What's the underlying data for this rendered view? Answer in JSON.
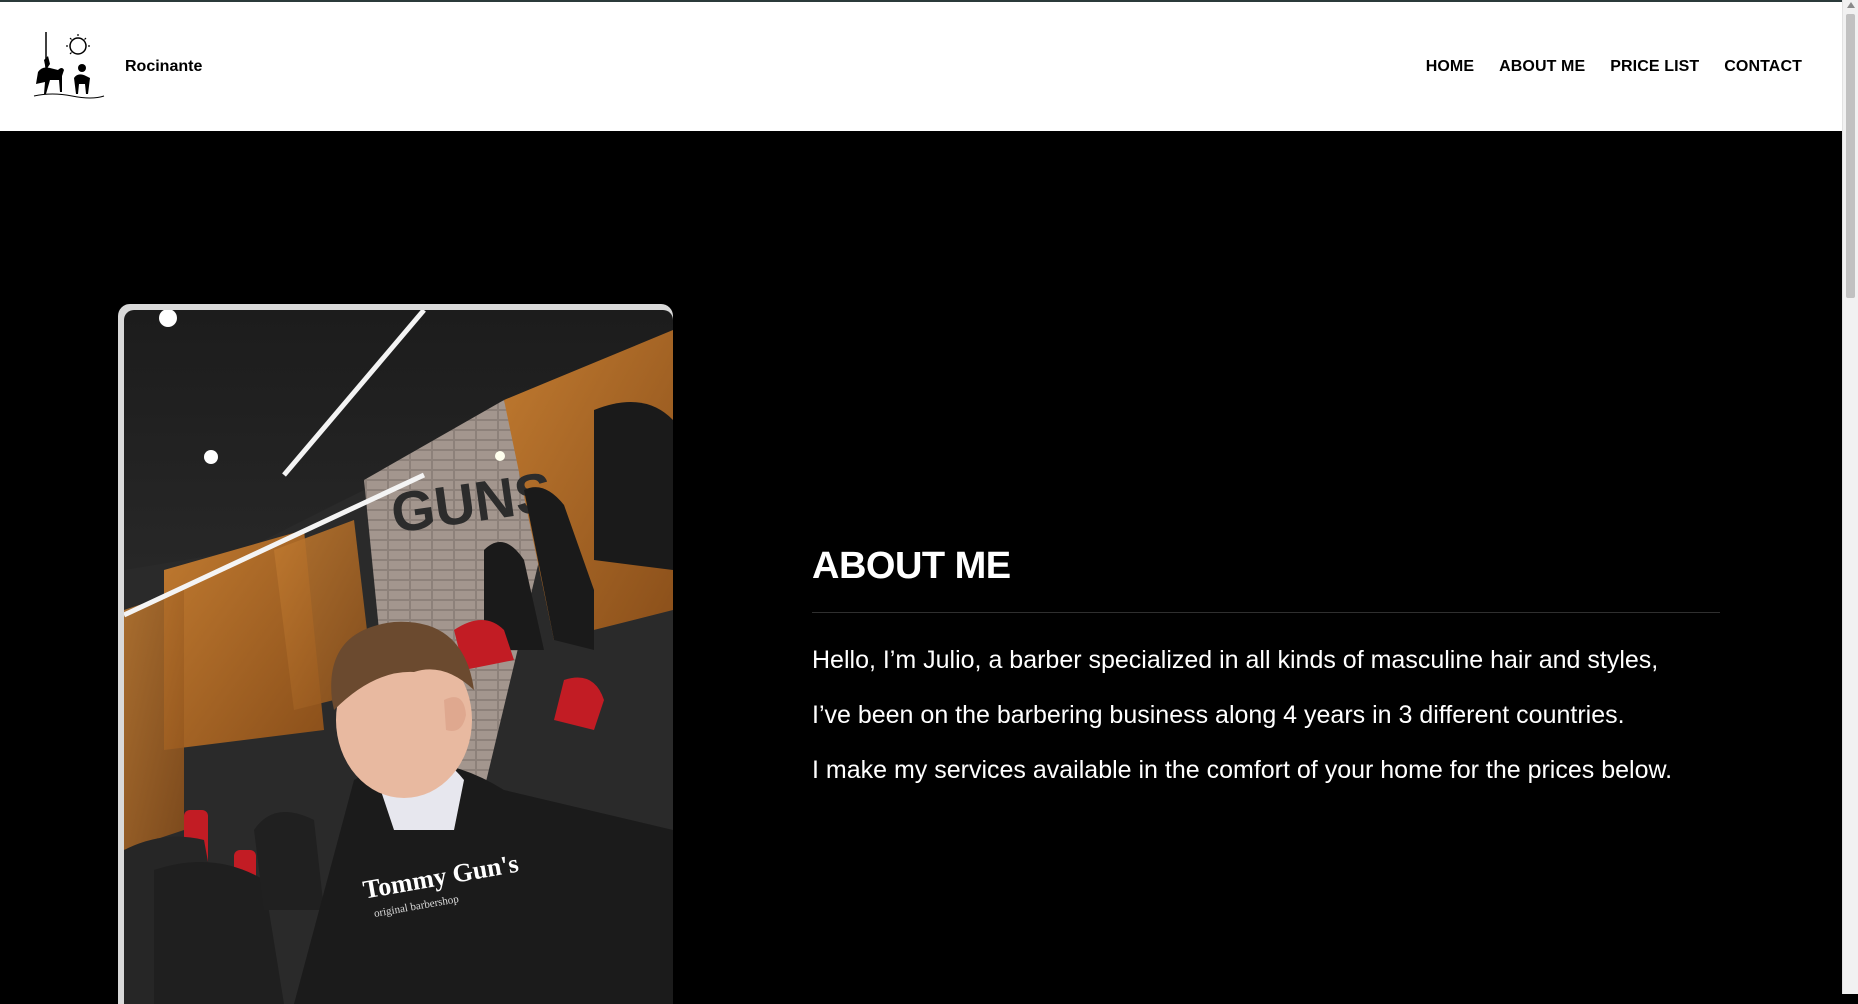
{
  "header": {
    "brand": "Rocinante",
    "nav": [
      "HOME",
      "ABOUT ME",
      "PRICE LIST",
      "CONTACT"
    ]
  },
  "about": {
    "title": "ABOUT ME",
    "paragraphs": [
      "Hello, I’m Julio, a barber specialized in all kinds of masculine hair and styles,",
      "I’ve been on the barbering business along 4 years in 3 different countries.",
      "I make my services available in the comfort of your home for the prices below."
    ]
  },
  "photo": {
    "cape_text_1": "Tommy Gun's",
    "cape_text_2": "original barbershop",
    "wall_text": "GUNS"
  },
  "colors": {
    "header_bg": "#ffffff",
    "page_bg": "#000000",
    "text_light": "#ffffff"
  }
}
